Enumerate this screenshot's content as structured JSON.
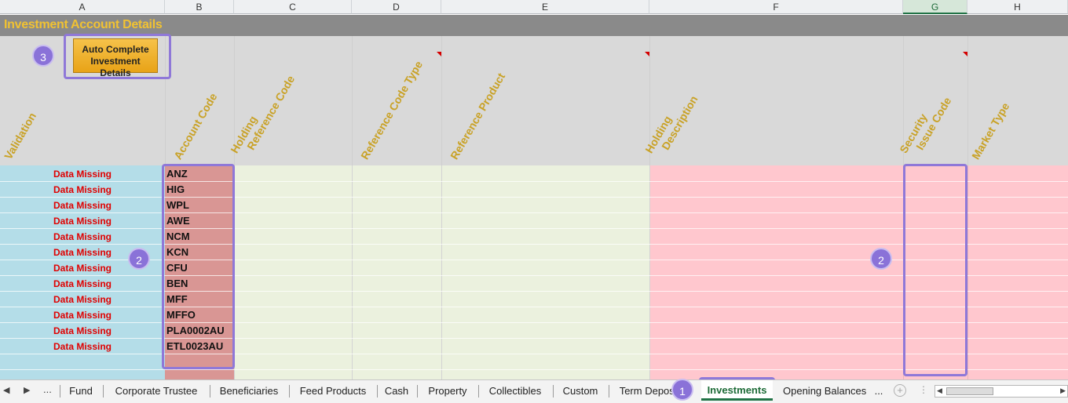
{
  "columns": [
    "A",
    "B",
    "C",
    "D",
    "E",
    "F",
    "G",
    "H"
  ],
  "selected_column": "G",
  "sheet_title": "Investment Account Details",
  "button_label_1": "Auto Complete",
  "button_label_2": "Investment Details",
  "headers": {
    "validation": "Validation",
    "account_code": "Account Code",
    "holding_ref_1": "Holding",
    "holding_ref_2": "Reference Code",
    "ref_code_type": "Reference Code Type",
    "ref_product": "Reference Product",
    "holding_desc_1": "Holding",
    "holding_desc_2": "Description",
    "security_1": "Security",
    "security_2": "Issue Code",
    "market_type": "Market Type"
  },
  "rows": [
    {
      "validation": "Data Missing",
      "account": "ANZ"
    },
    {
      "validation": "Data Missing",
      "account": "HIG"
    },
    {
      "validation": "Data Missing",
      "account": "WPL"
    },
    {
      "validation": "Data Missing",
      "account": "AWE"
    },
    {
      "validation": "Data Missing",
      "account": "NCM"
    },
    {
      "validation": "Data Missing",
      "account": "KCN"
    },
    {
      "validation": "Data Missing",
      "account": "CFU"
    },
    {
      "validation": "Data Missing",
      "account": "BEN"
    },
    {
      "validation": "Data Missing",
      "account": "MFF"
    },
    {
      "validation": "Data Missing",
      "account": "MFFO"
    },
    {
      "validation": "Data Missing",
      "account": "PLA0002AU"
    },
    {
      "validation": "Data Missing",
      "account": "ETL0023AU"
    }
  ],
  "badges": [
    "3",
    "2",
    "2",
    "1"
  ],
  "nav": {
    "prev": "◀",
    "next": "▶",
    "more": "..."
  },
  "tabs": [
    "Fund",
    "Corporate Trustee",
    "Beneficiaries",
    "Feed Products",
    "Cash",
    "Property",
    "Collectibles",
    "Custom",
    "Term Deposit",
    "Investments",
    "Opening Balances",
    "..."
  ],
  "active_tab": "Investments",
  "add_sheet_icon": "plus-circle-icon",
  "colors": {
    "validation_fill": "#b4dde8",
    "account_fill": "#d99694",
    "green_fill": "#ebf1de",
    "red_fill": "#ffc7ce",
    "header_text": "#c9a227",
    "callout": "#8f78d8"
  }
}
